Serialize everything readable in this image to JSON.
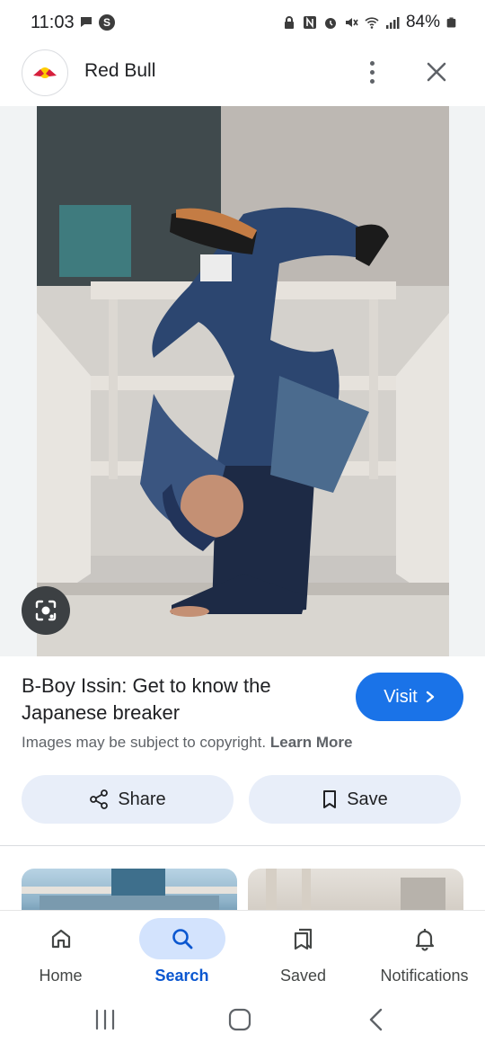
{
  "status_bar": {
    "time": "11:03",
    "battery": "84%",
    "left_icons": [
      "chat-bubble-icon",
      "s-badge-icon"
    ],
    "right_icons": [
      "lock-icon",
      "nfc-icon",
      "alarm-icon",
      "mute-icon",
      "wifi-icon",
      "signal-icon",
      "battery-icon"
    ]
  },
  "header": {
    "site_name": "Red Bull",
    "more_icon": "more-vertical-icon",
    "close_icon": "close-icon"
  },
  "image": {
    "lens_icon": "lens-icon"
  },
  "result": {
    "title": "B-Boy Issin: Get to know the Japanese breaker",
    "visit_label": "Visit",
    "copyright_text": "Images may be subject to copyright.",
    "learn_more": "Learn More"
  },
  "actions": {
    "share_label": "Share",
    "save_label": "Save"
  },
  "bottom_nav": {
    "items": [
      {
        "label": "Home",
        "icon": "home-icon",
        "active": false
      },
      {
        "label": "Search",
        "icon": "search-icon",
        "active": true
      },
      {
        "label": "Saved",
        "icon": "saved-icon",
        "active": false
      },
      {
        "label": "Notifications",
        "icon": "bell-icon",
        "active": false
      }
    ]
  },
  "colors": {
    "accent": "#1a73e8",
    "pill_bg": "#e8eef9",
    "active_nav": "#d3e3fd"
  }
}
